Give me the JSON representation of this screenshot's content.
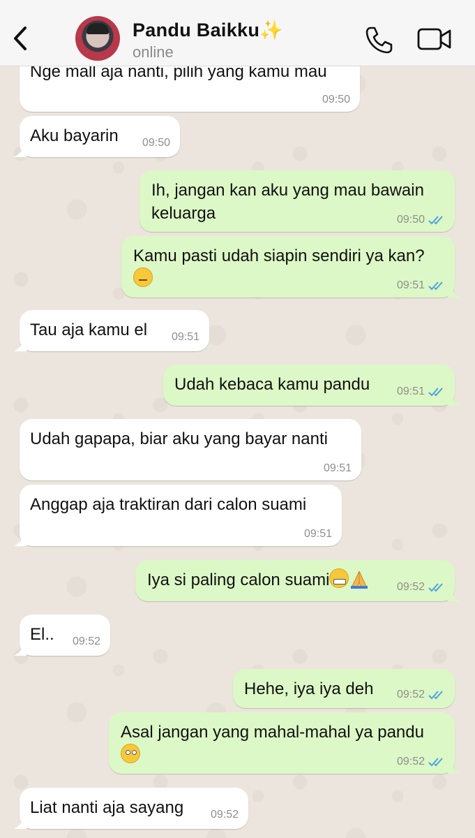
{
  "header": {
    "contact_name": "Pandu Baikku✨",
    "status": "online",
    "colors": {
      "header_bg": "#f6f6f6",
      "icon_color": "#111111"
    },
    "icons": {
      "back": "chevron-left-icon",
      "call": "phone-icon",
      "video": "video-camera-icon"
    }
  },
  "colors": {
    "incoming_bubble": "#ffffff",
    "outgoing_bubble": "#dcf8c6",
    "read_ticks": "#4fa3e0",
    "chat_background": "#ece5dd"
  },
  "messages": [
    {
      "direction": "in",
      "text": "Nge mall aja nanti, pilih yang kamu mau",
      "time": "09:50"
    },
    {
      "direction": "in",
      "text": "Aku bayarin",
      "time": "09:50"
    },
    {
      "direction": "out",
      "text": "Ih, jangan kan aku yang mau bawain\nkeluarga",
      "time": "09:50",
      "status": "read"
    },
    {
      "direction": "out",
      "text": "Kamu pasti udah siapin sendiri ya kan?\n",
      "emoji": "raised-eyebrow-face",
      "time": "09:51",
      "status": "read"
    },
    {
      "direction": "in",
      "text": "Tau aja kamu el",
      "time": "09:51"
    },
    {
      "direction": "out",
      "text": "Udah kebaca kamu pandu",
      "time": "09:51",
      "status": "read"
    },
    {
      "direction": "in",
      "text": "Udah gapapa, biar aku yang bayar nanti",
      "time": "09:51"
    },
    {
      "direction": "in",
      "text": "Anggap aja traktiran dari calon suami",
      "time": "09:51"
    },
    {
      "direction": "out",
      "text": "Iya si paling calon suami",
      "emoji": "grimacing-face praying-hands",
      "time": "09:52",
      "status": "read"
    },
    {
      "direction": "in",
      "text": "El..",
      "time": "09:52"
    },
    {
      "direction": "out",
      "text": "Hehe, iya iya deh",
      "time": "09:52",
      "status": "read"
    },
    {
      "direction": "out",
      "text": "Asal jangan yang mahal-mahal ya pandu\n",
      "emoji": "face-with-rolling-eyes",
      "time": "09:52",
      "status": "read"
    },
    {
      "direction": "in",
      "text": "Liat nanti aja sayang",
      "time": "09:52"
    }
  ]
}
